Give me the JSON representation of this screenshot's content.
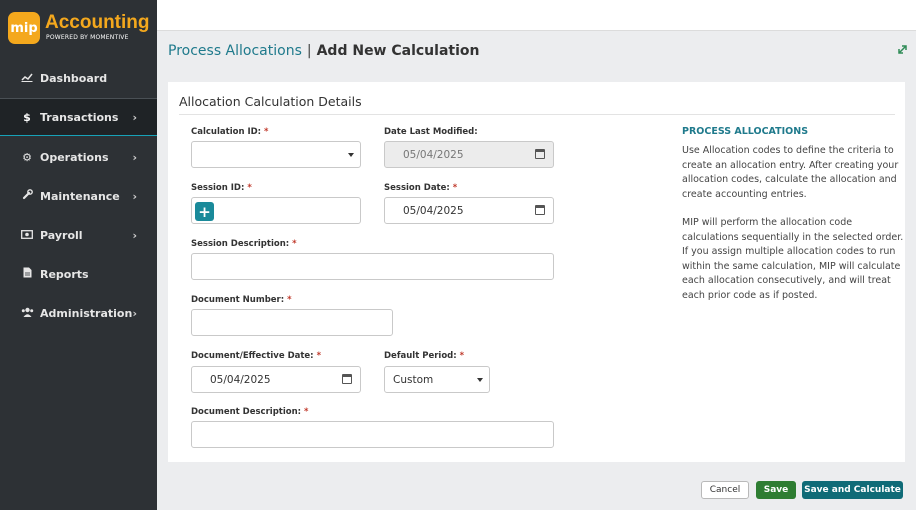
{
  "app": {
    "logo_badge": "mip",
    "logo_title": "Accounting",
    "logo_sub": "POWERED BY MOMENTIVE"
  },
  "sidebar": {
    "items": [
      {
        "label": "Dashboard",
        "icon": "chart-line-icon",
        "glyph": "📈"
      },
      {
        "label": "Transactions",
        "icon": "dollar-icon",
        "glyph": "$"
      },
      {
        "label": "Operations",
        "icon": "gears-icon",
        "glyph": "⚙"
      },
      {
        "label": "Maintenance",
        "icon": "wrench-icon",
        "glyph": "🔧"
      },
      {
        "label": "Payroll",
        "icon": "money-bill-icon",
        "glyph": "💵"
      },
      {
        "label": "Reports",
        "icon": "file-icon",
        "glyph": "📄"
      },
      {
        "label": "Administration",
        "icon": "users-icon",
        "glyph": "👥"
      }
    ],
    "active": "Transactions"
  },
  "header": {
    "breadcrumb_link": "Process Allocations",
    "separator": "|",
    "current": "Add New Calculation"
  },
  "form": {
    "section_title": "Allocation Calculation Details",
    "calculation_id": {
      "label": "Calculation ID:",
      "value": ""
    },
    "date_last_modified": {
      "label": "Date Last Modified:",
      "value": "05/04/2025"
    },
    "session_id": {
      "label": "Session ID:",
      "value": ""
    },
    "session_date": {
      "label": "Session Date:",
      "value": "05/04/2025"
    },
    "session_description": {
      "label": "Session Description:",
      "value": ""
    },
    "document_number": {
      "label": "Document Number:",
      "value": ""
    },
    "document_effective_date": {
      "label": "Document/Effective Date:",
      "value": "05/04/2025"
    },
    "default_period": {
      "label": "Default Period:",
      "value": "Custom"
    },
    "document_description": {
      "label": "Document Description:",
      "value": ""
    },
    "required_marker": "*"
  },
  "help": {
    "title": "PROCESS ALLOCATIONS",
    "para1": "Use Allocation codes to define the criteria to create an allocation entry. After creating your allocation codes, calculate the allocation and create accounting entries.",
    "para2": "MIP will perform the allocation code calculations sequentially in the selected order. If you assign multiple allocation codes to run within the same calculation, MIP will calculate each allocation consecutively, and will treat each prior code as if posted."
  },
  "footer": {
    "cancel": "Cancel",
    "save": "Save",
    "save_calc": "Save and Calculate"
  },
  "colors": {
    "accent": "#1f7a8c",
    "brand": "#f4a81d",
    "save": "#2e7d32",
    "save_calc": "#0f6b77",
    "required": "#c0392b"
  }
}
